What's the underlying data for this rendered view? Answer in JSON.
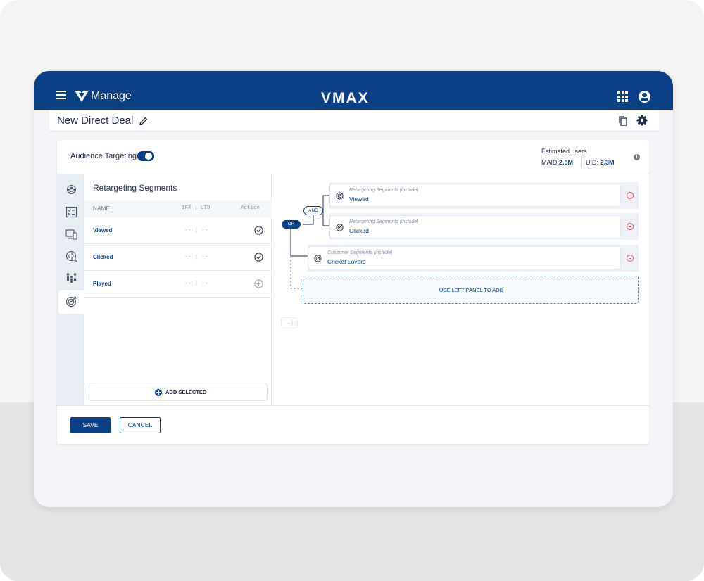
{
  "header": {
    "brand_name": "Manage",
    "product_logo": "VMAX",
    "icons": [
      "menu-icon",
      "brand-logo-icon",
      "apps-grid-icon",
      "account-icon"
    ]
  },
  "page": {
    "title": "New Direct Deal",
    "icons": [
      "edit-icon",
      "copy-icon",
      "settings-icon"
    ]
  },
  "targeting": {
    "label": "Audience Targeting",
    "enabled": true,
    "estimated_label": "Estimated users",
    "maid_label": "MAID:",
    "maid_value": "2.5M",
    "uid_label": "UID: ",
    "uid_value": "2.3M"
  },
  "rail": {
    "icons": [
      "audience-icon",
      "checklist-icon",
      "devices-icon",
      "location-icon",
      "demographics-icon",
      "target-icon"
    ],
    "active": "target-icon"
  },
  "segments": {
    "title": "Retargeting Segments",
    "columns": {
      "name": "NAME",
      "ifa_uid": "IFA | UID",
      "action": "Action"
    },
    "rows": [
      {
        "name": "Viewed",
        "ifa_uid": "-- | --",
        "action": "check-icon"
      },
      {
        "name": "Clicked",
        "ifa_uid": "-- | --",
        "action": "check-icon"
      },
      {
        "name": "Played",
        "ifa_uid": "-- | --",
        "action": "add-icon"
      }
    ],
    "add_selected": "ADD SELECTED"
  },
  "builder": {
    "and_label": "AND",
    "or_label": "OR",
    "rules": [
      {
        "caption": "Retargeting Segments (include)",
        "value": "Viewed"
      },
      {
        "caption": "Retargeting Segments (include)",
        "value": "Clicked"
      },
      {
        "caption": "Customer Segments (include)",
        "value": "Cricket Lovers"
      }
    ],
    "drop_zone": "USE LEFT PANEL TO ADD",
    "collapse": "→|"
  },
  "footer": {
    "save": "SAVE",
    "cancel": "CANCEL"
  },
  "colors": {
    "primary": "#0b3f86",
    "remove": "#e05555",
    "panel_bg": "#f2f4f7"
  }
}
